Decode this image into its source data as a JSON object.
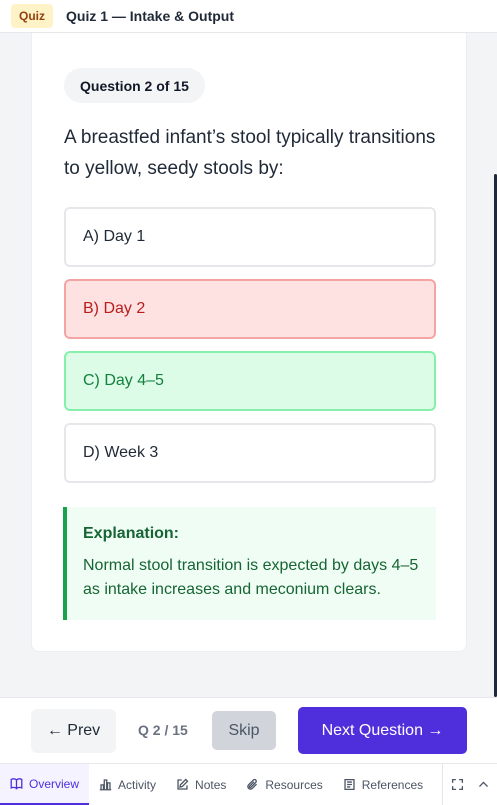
{
  "header": {
    "badge": "Quiz",
    "title": "Quiz 1 — Intake & Output"
  },
  "question": {
    "progress_label": "Question 2 of 15",
    "text": "A breastfed infant’s stool typically transitions to yellow, seedy stools by:",
    "options": [
      {
        "label": "A) Day 1",
        "state": "neutral"
      },
      {
        "label": "B) Day 2",
        "state": "incorrect"
      },
      {
        "label": "C) Day 4–5",
        "state": "correct"
      },
      {
        "label": "D) Week 3",
        "state": "neutral"
      }
    ]
  },
  "explanation": {
    "title": "Explanation:",
    "text": "Normal stool transition is expected by days 4–5 as intake increases and meconium clears."
  },
  "footer": {
    "prev_label": "← Prev",
    "counter": "Q 2 / 15",
    "skip_label": "Skip",
    "next_label": "Next Question →"
  },
  "tabs": [
    {
      "label": "Overview",
      "icon": "book-icon",
      "active": true
    },
    {
      "label": "Activity",
      "icon": "bar-chart-icon",
      "active": false
    },
    {
      "label": "Notes",
      "icon": "edit-icon",
      "active": false
    },
    {
      "label": "Resources",
      "icon": "paperclip-icon",
      "active": false
    },
    {
      "label": "References",
      "icon": "document-icon",
      "active": false
    }
  ],
  "colors": {
    "accent": "#4f2fdc",
    "correct": "#15803d",
    "incorrect": "#b91c1c"
  }
}
